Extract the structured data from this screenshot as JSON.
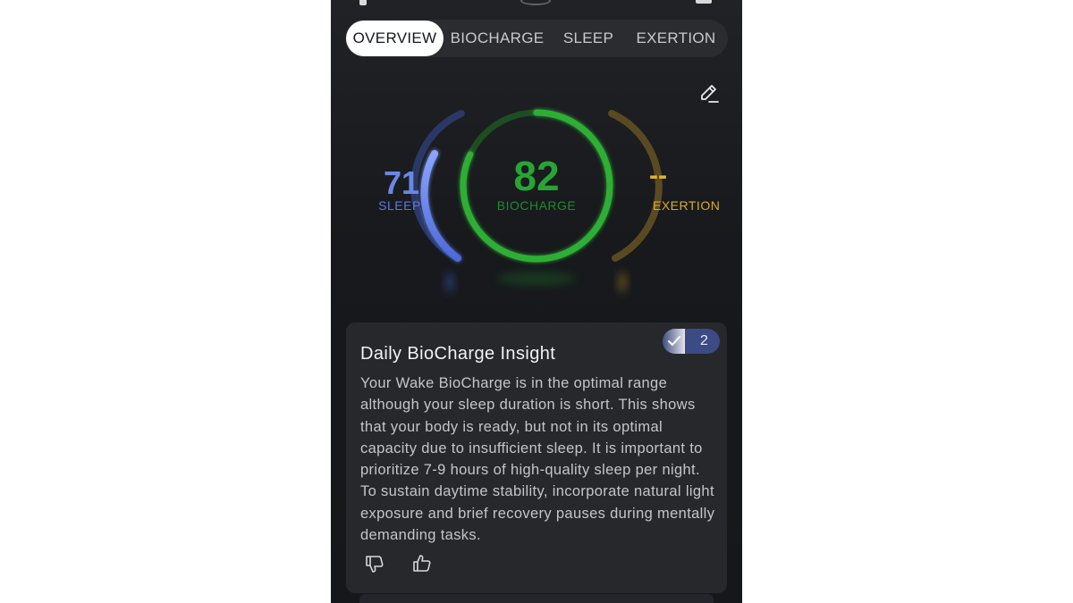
{
  "tabs": [
    {
      "label": "OVERVIEW",
      "active": true
    },
    {
      "label": "BIOCHARGE",
      "active": false
    },
    {
      "label": "SLEEP",
      "active": false
    },
    {
      "label": "EXERTION",
      "active": false
    }
  ],
  "icons": {
    "edit": "pencil-icon",
    "badge": "check-icon",
    "dislike": "thumbs-down-icon",
    "like": "thumbs-up-icon"
  },
  "metrics": {
    "sleep": {
      "value": "71",
      "label": "SLEEP",
      "color": "#6b86e3"
    },
    "biocharge": {
      "value": "82",
      "label": "BIOCHARGE",
      "color": "#27a534",
      "progress": 0.82
    },
    "exertion": {
      "value": "--",
      "label": "EXERTION",
      "color": "#e0b52b"
    }
  },
  "insight": {
    "title": "Daily BioCharge Insight",
    "badge_count": "2",
    "body": "Your Wake BioCharge is in the optimal range although your sleep duration is short. This shows that your body is ready, but not in its optimal capacity due to insufficient sleep. It is important to prioritize 7-9 hours of high-quality sleep per night. To sustain daytime stability, incorporate natural light exposure and brief recovery pauses during mentally demanding tasks."
  }
}
